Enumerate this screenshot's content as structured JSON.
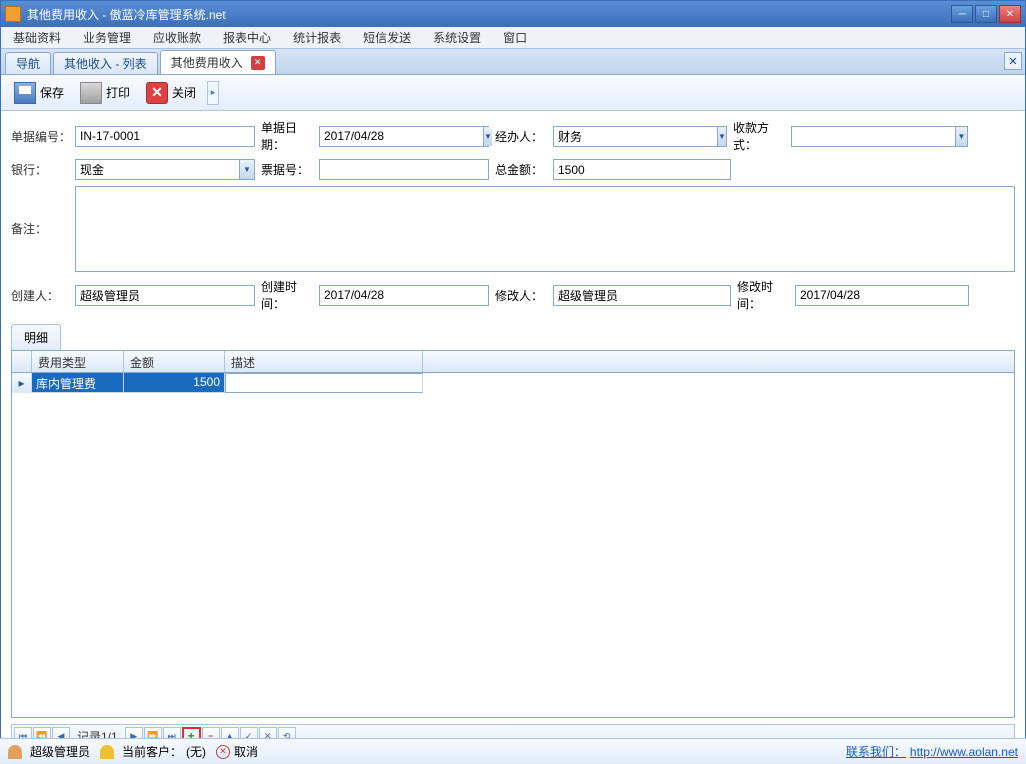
{
  "title": "其他费用收入 - 傲蓝冷库管理系统.net",
  "menubar": [
    "基础资料",
    "业务管理",
    "应收账款",
    "报表中心",
    "统计报表",
    "短信发送",
    "系统设置",
    "窗口"
  ],
  "tabs": [
    {
      "label": "导航",
      "closable": false
    },
    {
      "label": "其他收入 - 列表",
      "closable": false
    },
    {
      "label": "其他费用收入",
      "closable": true
    }
  ],
  "toolbar": {
    "save": "保存",
    "print": "打印",
    "close": "关闭"
  },
  "form": {
    "doc_no_label": "单据编号：",
    "doc_no": "IN-17-0001",
    "doc_date_label": "单据日期：",
    "doc_date": "2017/04/28",
    "handler_label": "经办人：",
    "handler": "财务",
    "pay_type_label": "收款方式：",
    "pay_type": "",
    "bank_label": "银行：",
    "bank": "现金",
    "ticket_no_label": "票据号：",
    "ticket_no": "",
    "total_label": "总金额：",
    "total": "1500",
    "remark_label": "备注：",
    "remark": "",
    "creator_label": "创建人：",
    "creator": "超级管理员",
    "create_time_label": "创建时间：",
    "create_time": "2017/04/28",
    "modifier_label": "修改人：",
    "modifier": "超级管理员",
    "modify_time_label": "修改时间：",
    "modify_time": "2017/04/28"
  },
  "detail_tab": "明细",
  "grid": {
    "headers": {
      "type": "费用类型",
      "amount": "金额",
      "desc": "描述"
    },
    "rows": [
      {
        "type": "库内管理费",
        "amount": "1500",
        "desc": ""
      }
    ]
  },
  "navigator": {
    "record_text": "记录1/1"
  },
  "statusbar": {
    "user": "超级管理员",
    "current_customer_label": "当前客户：",
    "current_customer": "(无)",
    "cancel": "取消",
    "contact_label": "联系我们：",
    "contact_url": "http://www.aolan.net"
  }
}
